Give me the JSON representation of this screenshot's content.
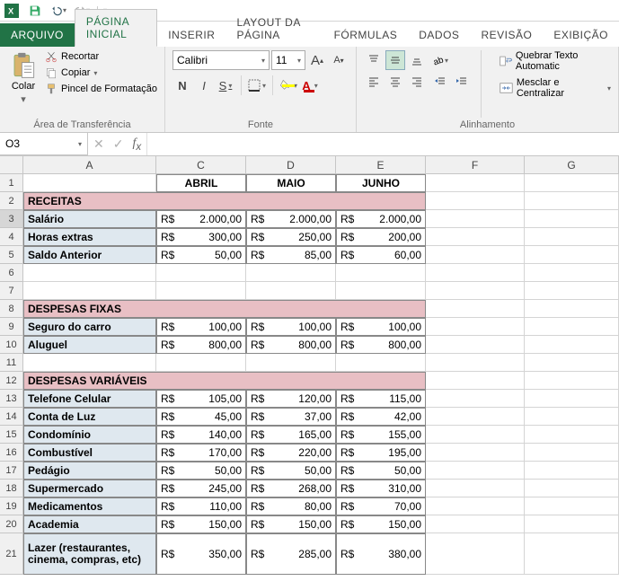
{
  "qat": {
    "save": "save",
    "undo": "undo",
    "redo": "redo"
  },
  "tabs": {
    "file": "ARQUIVO",
    "home": "PÁGINA INICIAL",
    "insert": "INSERIR",
    "layout": "LAYOUT DA PÁGINA",
    "formulas": "FÓRMULAS",
    "data": "DADOS",
    "review": "REVISÃO",
    "view": "EXIBIÇÃO"
  },
  "ribbon": {
    "clipboard": {
      "paste": "Colar",
      "cut": "Recortar",
      "copy": "Copiar",
      "format_painter": "Pincel de Formatação",
      "title": "Área de Transferência"
    },
    "font": {
      "name": "Calibri",
      "size": "11",
      "bold": "N",
      "italic": "I",
      "underline": "S",
      "title": "Fonte"
    },
    "alignment": {
      "wrap": "Quebrar Texto Automatic",
      "merge": "Mesclar e Centralizar",
      "title": "Alinhamento"
    }
  },
  "namebox": "O3",
  "columns": [
    {
      "letter": "A",
      "w": 148
    },
    {
      "letter": "C",
      "w": 100
    },
    {
      "letter": "D",
      "w": 100
    },
    {
      "letter": "E",
      "w": 100
    },
    {
      "letter": "F",
      "w": 110
    },
    {
      "letter": "G",
      "w": 105
    }
  ],
  "grid": {
    "headers": {
      "c": "ABRIL",
      "d": "MAIO",
      "e": "JUNHO"
    },
    "sections": [
      {
        "row": 2,
        "title": "RECEITAS"
      },
      {
        "row": 8,
        "title": "DESPESAS FIXAS"
      },
      {
        "row": 12,
        "title": "DESPESAS VARIÁVEIS"
      }
    ],
    "rows": [
      {
        "n": 3,
        "label": "Salário",
        "c": "2.000,00",
        "d": "2.000,00",
        "e": "2.000,00",
        "sel": true
      },
      {
        "n": 4,
        "label": "Horas extras",
        "c": "300,00",
        "d": "250,00",
        "e": "200,00"
      },
      {
        "n": 5,
        "label": "Saldo Anterior",
        "c": "50,00",
        "d": "85,00",
        "e": "60,00"
      },
      {
        "n": 9,
        "label": "Seguro do carro",
        "c": "100,00",
        "d": "100,00",
        "e": "100,00"
      },
      {
        "n": 10,
        "label": "Aluguel",
        "c": "800,00",
        "d": "800,00",
        "e": "800,00"
      },
      {
        "n": 13,
        "label": "Telefone Celular",
        "c": "105,00",
        "d": "120,00",
        "e": "115,00"
      },
      {
        "n": 14,
        "label": "Conta de Luz",
        "c": "45,00",
        "d": "37,00",
        "e": "42,00"
      },
      {
        "n": 15,
        "label": "Condomínio",
        "c": "140,00",
        "d": "165,00",
        "e": "155,00"
      },
      {
        "n": 16,
        "label": "Combustível",
        "c": "170,00",
        "d": "220,00",
        "e": "195,00"
      },
      {
        "n": 17,
        "label": "Pedágio",
        "c": "50,00",
        "d": "50,00",
        "e": "50,00"
      },
      {
        "n": 18,
        "label": "Supermercado",
        "c": "245,00",
        "d": "268,00",
        "e": "310,00"
      },
      {
        "n": 19,
        "label": "Medicamentos",
        "c": "110,00",
        "d": "80,00",
        "e": "70,00"
      },
      {
        "n": 20,
        "label": "Academia",
        "c": "150,00",
        "d": "150,00",
        "e": "150,00"
      },
      {
        "n": 21,
        "label": "Lazer (restaurantes, cinema, compras, etc)",
        "c": "350,00",
        "d": "285,00",
        "e": "380,00",
        "tall": true
      }
    ],
    "currency": "R$"
  }
}
